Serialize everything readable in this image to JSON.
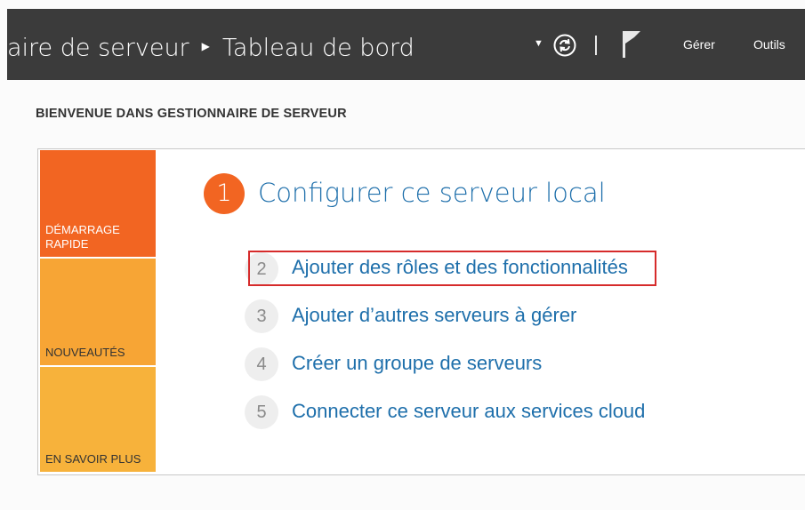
{
  "header": {
    "breadcrumb_app": "aire de serveur",
    "breadcrumb_page": "Tableau de bord",
    "menu_manage": "Gérer",
    "menu_tools": "Outils",
    "background_color": "#3b3b3b"
  },
  "welcome": {
    "title": "BIENVENUE DANS GESTIONNAIRE DE SERVEUR",
    "tiles": [
      {
        "label": "DÉMARRAGE RAPIDE",
        "color": "#f26522"
      },
      {
        "label": "NOUVEAUTÉS",
        "color": "#f7a535"
      },
      {
        "label": "EN SAVOIR PLUS",
        "color": "#f7b23b"
      }
    ],
    "steps": [
      {
        "number": "1",
        "label": "Configurer ce serveur local"
      },
      {
        "number": "2",
        "label": "Ajouter des rôles et des fonctionnalités",
        "highlighted": true
      },
      {
        "number": "3",
        "label": "Ajouter d’autres serveurs à gérer"
      },
      {
        "number": "4",
        "label": "Créer un groupe de serveurs"
      },
      {
        "number": "5",
        "label": "Connecter ce serveur aux services cloud"
      }
    ]
  },
  "icons": {
    "breadcrumb_separator": "chevron-right-icon",
    "dropdown": "caret-down-icon",
    "refresh": "refresh-icon",
    "notifications": "flag-icon"
  },
  "colors": {
    "accent_orange": "#f26522",
    "link_blue": "#1e6fab",
    "highlight_red": "#d62b2b"
  }
}
